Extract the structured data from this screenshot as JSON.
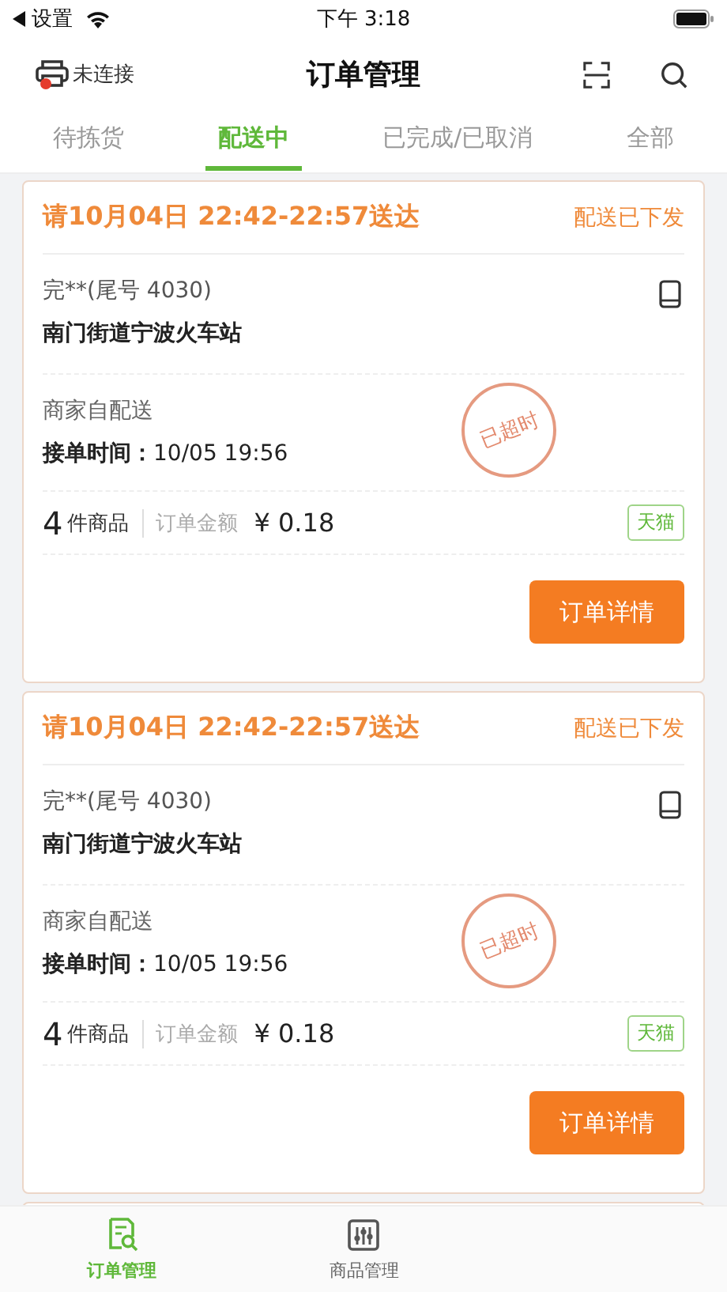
{
  "status_bar": {
    "back_label": "设置",
    "time": "下午 3:18"
  },
  "header": {
    "printer_label": "未连接",
    "printer_connected": false,
    "title": "订单管理"
  },
  "tabs": [
    {
      "label": "待拣货",
      "selected": false
    },
    {
      "label": "配送中",
      "selected": true
    },
    {
      "label": "已完成/已取消",
      "selected": false
    },
    {
      "label": "全部",
      "selected": false
    }
  ],
  "orders": [
    {
      "deadline": "请10月04日 22:42-22:57送达",
      "status": "配送已下发",
      "customer": "完**(尾号 4030)",
      "address": "南门街道宁波火车站",
      "delivery_method": "商家自配送",
      "accept_label": "接单时间：",
      "accept_time": "10/05 19:56",
      "stamp": "已超时",
      "item_count": "4",
      "item_unit": "件商品",
      "amount_label": "订单金额",
      "amount": "¥ 0.18",
      "platform": "天猫",
      "button": "订单详情"
    },
    {
      "deadline": "请10月04日 22:42-22:57送达",
      "status": "配送已下发",
      "customer": "完**(尾号 4030)",
      "address": "南门街道宁波火车站",
      "delivery_method": "商家自配送",
      "accept_label": "接单时间：",
      "accept_time": "10/05 19:56",
      "stamp": "已超时",
      "item_count": "4",
      "item_unit": "件商品",
      "amount_label": "订单金额",
      "amount": "¥ 0.18",
      "platform": "天猫",
      "button": "订单详情"
    }
  ],
  "bottom_nav": [
    {
      "label": "订单管理",
      "kind": "orders",
      "selected": true
    },
    {
      "label": "商品管理",
      "kind": "goods",
      "selected": false
    }
  ]
}
